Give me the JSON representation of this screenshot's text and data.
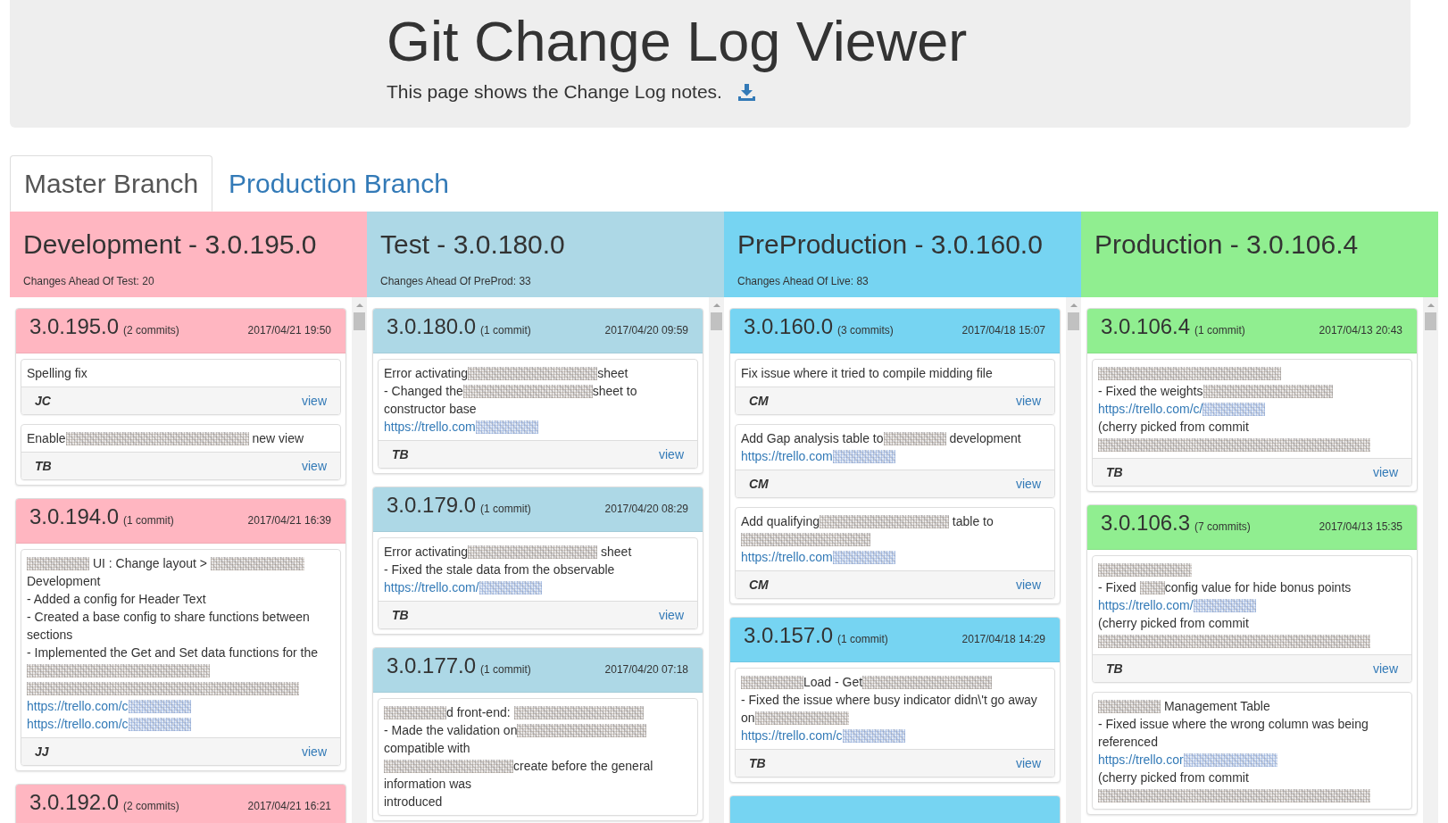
{
  "header": {
    "title": "Git Change Log Viewer",
    "subtitle": "This page shows the Change Log notes."
  },
  "tabs": [
    {
      "label": "Master Branch",
      "selected": true
    },
    {
      "label": "Production Branch",
      "selected": false
    }
  ],
  "columns": [
    {
      "title": "Development - 3.0.195.0",
      "changes_ahead": "Changes Ahead Of Test: 20",
      "color": "#ffb6c1",
      "releases": [
        {
          "kind": "card",
          "version": "3.0.195.0",
          "commit_count": "(2 commits)",
          "date": "2017/04/21 19:50",
          "commits": [
            {
              "message": [
                [
                  {
                    "kind": "text",
                    "text": "Spelling fix"
                  }
                ]
              ],
              "author": "JC",
              "action": "view"
            },
            {
              "message": [
                [
                  {
                    "kind": "text",
                    "text": "Enable"
                  },
                  {
                    "kind": "blur_wide"
                  },
                  {
                    "kind": "text",
                    "text": " new view"
                  }
                ]
              ],
              "author": "TB",
              "action": "view"
            }
          ]
        },
        {
          "kind": "card",
          "version": "3.0.194.0",
          "commit_count": "(1 commit)",
          "date": "2017/04/21 16:39",
          "commits": [
            {
              "message": [
                [
                  {
                    "kind": "blur_short"
                  },
                  {
                    "kind": "text",
                    "text": " UI : Change layout > "
                  },
                  {
                    "kind": "blur_medium"
                  },
                  {
                    "kind": "text",
                    "text": " Development"
                  }
                ],
                [
                  {
                    "kind": "text",
                    "text": "- Added a config for Header Text"
                  }
                ],
                [
                  {
                    "kind": "text",
                    "text": "- Created a base config to share functions between sections"
                  }
                ],
                [
                  {
                    "kind": "text",
                    "text": "- Implemented the Get and Set data functions for the "
                  },
                  {
                    "kind": "blur_wide"
                  },
                  {
                    "kind": "blur_full"
                  }
                ],
                [
                  {
                    "kind": "link",
                    "text": "https://trello.com/c"
                  },
                  {
                    "kind": "blur_short"
                  }
                ],
                [
                  {
                    "kind": "link",
                    "text": "https://trello.com/c"
                  },
                  {
                    "kind": "blur_short"
                  }
                ]
              ],
              "author": "JJ",
              "action": "view"
            }
          ]
        },
        {
          "kind": "card",
          "version": "3.0.192.0",
          "commit_count": "(2 commits)",
          "date": "2017/04/21 16:21"
        }
      ]
    },
    {
      "title": "Test - 3.0.180.0",
      "changes_ahead": "Changes Ahead Of PreProd: 33",
      "color": "#add8e6",
      "releases": [
        {
          "kind": "card",
          "version": "3.0.180.0",
          "commit_count": "(1 commit)",
          "date": "2017/04/20 09:59",
          "commits": [
            {
              "message": [
                [
                  {
                    "kind": "text",
                    "text": "Error activating"
                  },
                  {
                    "kind": "blur_long"
                  },
                  {
                    "kind": "text",
                    "text": "sheet"
                  }
                ],
                [
                  {
                    "kind": "text",
                    "text": "- Changed the"
                  },
                  {
                    "kind": "blur_long"
                  },
                  {
                    "kind": "text",
                    "text": "sheet to constructor base"
                  }
                ],
                [
                  {
                    "kind": "link",
                    "text": "https://trello.com"
                  },
                  {
                    "kind": "blur_short"
                  }
                ]
              ],
              "author": "TB",
              "action": "view"
            }
          ]
        },
        {
          "kind": "card",
          "version": "3.0.179.0",
          "commit_count": "(1 commit)",
          "date": "2017/04/20 08:29",
          "commits": [
            {
              "message": [
                [
                  {
                    "kind": "text",
                    "text": "Error activating"
                  },
                  {
                    "kind": "blur_long"
                  },
                  {
                    "kind": "text",
                    "text": " sheet"
                  }
                ],
                [
                  {
                    "kind": "text",
                    "text": "- Fixed the stale data from the observable"
                  }
                ],
                [
                  {
                    "kind": "link",
                    "text": "https://trello.com/"
                  },
                  {
                    "kind": "blur_short"
                  }
                ]
              ],
              "author": "TB",
              "action": "view"
            }
          ]
        },
        {
          "kind": "card",
          "version": "3.0.177.0",
          "commit_count": "(1 commit)",
          "date": "2017/04/20 07:18",
          "commits": [
            {
              "message": [
                [
                  {
                    "kind": "blur_short"
                  },
                  {
                    "kind": "text",
                    "text": "d front-end: "
                  },
                  {
                    "kind": "blur_long"
                  }
                ],
                [
                  {
                    "kind": "text",
                    "text": "- Made the validation on"
                  },
                  {
                    "kind": "blur_long"
                  },
                  {
                    "kind": "text",
                    "text": " compatible with"
                  }
                ],
                [
                  {
                    "kind": "blur_long"
                  },
                  {
                    "kind": "text",
                    "text": "create before the general information was"
                  }
                ],
                [
                  {
                    "kind": "text",
                    "text": "introduced"
                  }
                ]
              ]
            }
          ]
        }
      ]
    },
    {
      "title": "PreProduction - 3.0.160.0",
      "changes_ahead": "Changes Ahead Of Live: 83",
      "color": "#76d4f2",
      "releases": [
        {
          "kind": "card",
          "version": "3.0.160.0",
          "commit_count": "(3 commits)",
          "date": "2017/04/18 15:07",
          "commits": [
            {
              "message": [
                [
                  {
                    "kind": "text",
                    "text": "Fix issue where it tried to compile midding file"
                  }
                ]
              ],
              "author": "CM",
              "action": "view"
            },
            {
              "message": [
                [
                  {
                    "kind": "text",
                    "text": "Add Gap analysis table to"
                  },
                  {
                    "kind": "blur_short"
                  },
                  {
                    "kind": "text",
                    "text": " development"
                  }
                ],
                [
                  {
                    "kind": "link",
                    "text": "https://trello.com"
                  },
                  {
                    "kind": "blur_short"
                  }
                ]
              ],
              "author": "CM",
              "action": "view"
            },
            {
              "message": [
                [
                  {
                    "kind": "text",
                    "text": "Add qualifying"
                  },
                  {
                    "kind": "blur_long"
                  },
                  {
                    "kind": "text",
                    "text": " table to "
                  },
                  {
                    "kind": "blur_long"
                  }
                ],
                [
                  {
                    "kind": "link",
                    "text": "https://trello.com"
                  },
                  {
                    "kind": "blur_short"
                  }
                ]
              ],
              "author": "CM",
              "action": "view"
            }
          ]
        },
        {
          "kind": "card",
          "version": "3.0.157.0",
          "commit_count": "(1 commit)",
          "date": "2017/04/18 14:29",
          "commits": [
            {
              "message": [
                [
                  {
                    "kind": "blur_short"
                  },
                  {
                    "kind": "text",
                    "text": "Load - Get"
                  },
                  {
                    "kind": "blur_long"
                  }
                ],
                [
                  {
                    "kind": "text",
                    "text": "- Fixed the issue where busy indicator didn\\'t go away on"
                  },
                  {
                    "kind": "blur_medium"
                  }
                ],
                [
                  {
                    "kind": "link",
                    "text": "https://trello.com/c"
                  },
                  {
                    "kind": "blur_short"
                  }
                ]
              ],
              "author": "TB",
              "action": "view"
            }
          ]
        },
        {
          "kind": "strip"
        }
      ]
    },
    {
      "title": "Production - 3.0.106.4",
      "color": "#90ee90",
      "releases": [
        {
          "kind": "card",
          "version": "3.0.106.4",
          "commit_count": "(1 commit)",
          "date": "2017/04/13 20:43",
          "commits": [
            {
              "message": [
                [
                  {
                    "kind": "blur_wide"
                  }
                ],
                [
                  {
                    "kind": "text",
                    "text": "- Fixed the weights"
                  },
                  {
                    "kind": "blur_long"
                  }
                ],
                [
                  {
                    "kind": "link",
                    "text": "https://trello.com/c/"
                  },
                  {
                    "kind": "blur_short"
                  }
                ],
                [
                  {
                    "kind": "text",
                    "text": "(cherry picked from commit "
                  },
                  {
                    "kind": "blur_full"
                  }
                ]
              ],
              "author": "TB",
              "action": "view"
            }
          ]
        },
        {
          "kind": "card",
          "version": "3.0.106.3",
          "commit_count": "(7 commits)",
          "date": "2017/04/13 15:35",
          "commits": [
            {
              "message": [
                [
                  {
                    "kind": "blur_medium"
                  }
                ],
                [
                  {
                    "kind": "text",
                    "text": "- Fixed "
                  },
                  {
                    "kind": "blur_tiny"
                  },
                  {
                    "kind": "text",
                    "text": "config value for hide bonus points"
                  }
                ],
                [
                  {
                    "kind": "link",
                    "text": "https://trello.com/"
                  },
                  {
                    "kind": "blur_short"
                  }
                ],
                [
                  {
                    "kind": "text",
                    "text": "(cherry picked from commit "
                  },
                  {
                    "kind": "blur_full"
                  }
                ]
              ],
              "author": "TB",
              "action": "view"
            },
            {
              "message": [
                [
                  {
                    "kind": "blur_short"
                  },
                  {
                    "kind": "text",
                    "text": " Management Table"
                  }
                ],
                [
                  {
                    "kind": "text",
                    "text": "- Fixed issue where the wrong column was being referenced"
                  }
                ],
                [
                  {
                    "kind": "link",
                    "text": "https://trello.cor"
                  },
                  {
                    "kind": "blur_medium"
                  }
                ],
                [
                  {
                    "kind": "text",
                    "text": "(cherry picked from commit "
                  },
                  {
                    "kind": "blur_full"
                  }
                ]
              ]
            }
          ]
        }
      ]
    }
  ]
}
